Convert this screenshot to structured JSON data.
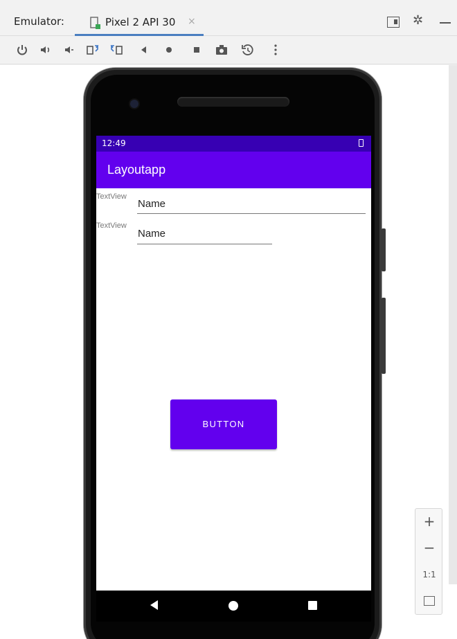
{
  "window": {
    "label": "Emulator:",
    "tab_title": "Pixel 2 API 30",
    "tab_close": "×"
  },
  "toolbar": {
    "tools": [
      "power-icon",
      "volume-up-icon",
      "volume-down-icon",
      "rotate-left-icon",
      "rotate-right-icon",
      "back-icon",
      "home-icon",
      "overview-icon",
      "screenshot-icon",
      "snapshot-icon",
      "more-icon"
    ]
  },
  "device": {
    "status_time": "12:49",
    "app_title": "Layoutapp",
    "rows": [
      {
        "label": "TextView",
        "value": "Name"
      },
      {
        "label": "TextView",
        "value": "Name"
      }
    ],
    "button_label": "BUTTON",
    "colors": {
      "status": "#3700b3",
      "primary": "#6200ee"
    }
  },
  "zoom": {
    "plus": "+",
    "minus": "−",
    "one_to_one": "1:1"
  }
}
